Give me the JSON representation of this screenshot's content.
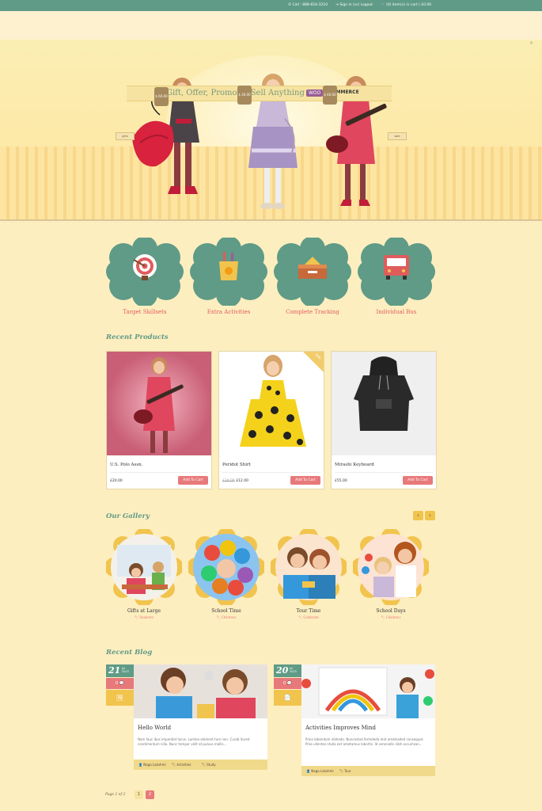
{
  "topbar": {
    "call": "Call : 888-654-3210",
    "account": "Sign in (or) Logout",
    "cart": "(0) item(s) in cart | £0.00"
  },
  "hero": {
    "headline": "Gift, Offer, Promote! Sell Anything",
    "woo_logo_left": "WOO",
    "woo_logo_right": "COMMERCE",
    "price_tag_1": "$ 60.00",
    "price_tag_2": "$ 30.00",
    "price_tag_3": "$ 40.00",
    "side_tag_left": "girls",
    "side_tag_right": "sale",
    "close": "×"
  },
  "features": [
    {
      "label": "Target Skillsets",
      "icon": "target-icon"
    },
    {
      "label": "Extra Activities",
      "icon": "pencil-cup-icon"
    },
    {
      "label": "Complete Tracking",
      "icon": "toolbox-icon"
    },
    {
      "label": "Individual Bus",
      "icon": "bus-icon"
    }
  ],
  "recent_products": {
    "title": "Recent Products",
    "items": [
      {
        "name": "U.S. Polo Assn.",
        "old_price": "",
        "price": "£20.00",
        "cart": "Add To Cart",
        "sale": ""
      },
      {
        "name": "Peridot Shirt",
        "old_price": "£24.00",
        "price": "£12.00",
        "cart": "Add To Cart",
        "sale": "Sale"
      },
      {
        "name": "Mirashi Keyboard",
        "old_price": "",
        "price": "£55.00",
        "cart": "Add To Cart",
        "sale": ""
      }
    ]
  },
  "gallery": {
    "title": "Our Gallery",
    "prev": "‹",
    "next": "›",
    "items": [
      {
        "title": "Gifts at Large",
        "category": "Students"
      },
      {
        "title": "School Time",
        "category": "Childrens"
      },
      {
        "title": "Tour Time",
        "category": "Celebrate"
      },
      {
        "title": "School Days",
        "category": "Childrens"
      }
    ]
  },
  "recent_blog": {
    "title": "Recent Blog",
    "posts": [
      {
        "day": "21",
        "month": "Jul",
        "year": "2015",
        "comments": "0 💬",
        "type_icon": "🖼",
        "title": "Hello World",
        "excerpt": "Nam fauc ibus imperdiet lacus. Lumleo element tum non. Curab itured condimentum nilla. Nunc tempor velit at pulvus mollis...",
        "author": "👤 Naga Lakshmi",
        "category": "Activities",
        "tag": "🏷 Study"
      },
      {
        "day": "20",
        "month": "Jul",
        "year": "2015",
        "comments": "0 💬",
        "type_icon": "📄",
        "title": "Activities Improves Mind",
        "excerpt": "Proin bibendum nibhodo. Nuncestod fermdeda mot ametsaded consequat. Prae ullentes ntulla ext ametamus lobortis. Id venenatis nibh accumsan...",
        "author": "👤 Naga Lakshmi",
        "category": "Tour",
        "tag": ""
      }
    ]
  },
  "pagination": {
    "text": "Page 1 of 2",
    "pages": [
      "1",
      "2"
    ]
  },
  "colors": {
    "green": "#5f9b86",
    "coral": "#e8797a",
    "yellow": "#f1c44e",
    "background": "#fdeec0"
  }
}
